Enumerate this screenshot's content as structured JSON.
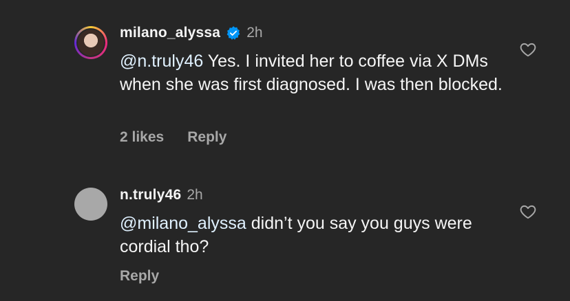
{
  "comments": [
    {
      "username": "milano_alyssa",
      "verified": true,
      "time": "2h",
      "mention": "@n.truly46",
      "text": " Yes. I invited her to coffee via X DMs when she was first diagnosed. I was then blocked.",
      "likes": "2 likes",
      "reply": "Reply"
    },
    {
      "username": "n.truly46",
      "verified": false,
      "time": "2h",
      "mention": "@milano_alyssa",
      "text": " didn’t you say you guys were cordial tho?",
      "reply": "Reply"
    }
  ],
  "icons": {
    "verified": "verified-badge-icon",
    "like": "heart-icon"
  },
  "colors": {
    "background": "#262626",
    "text": "#f5f5f5",
    "secondary": "#a8a8a8",
    "verified": "#0095f6"
  }
}
